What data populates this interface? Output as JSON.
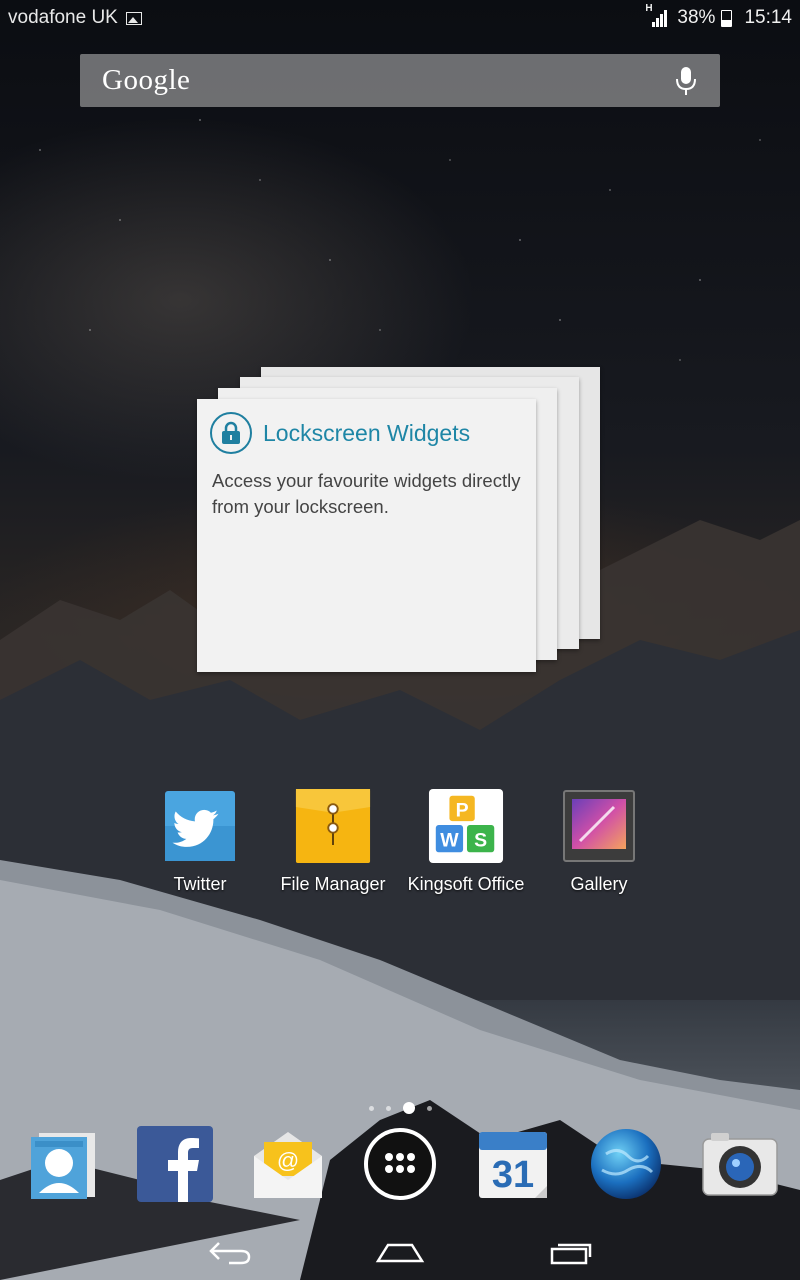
{
  "status_bar": {
    "carrier": "vodafone UK",
    "network_type": "H",
    "battery_percent": "38%",
    "battery_level": 0.38,
    "time": "15:14"
  },
  "search": {
    "logo_text": "Google",
    "mic_icon": "microphone-icon"
  },
  "widget": {
    "title": "Lockscreen Widgets",
    "description": "Access your favourite widgets directly from your lockscreen.",
    "icon": "lock-icon",
    "accent_color": "#1e86a6"
  },
  "apps": [
    {
      "label": "Twitter",
      "icon": "twitter-icon"
    },
    {
      "label": "File Manager",
      "icon": "file-manager-icon"
    },
    {
      "label": "Kingsoft Office",
      "icon": "kingsoft-office-icon"
    },
    {
      "label": "Gallery",
      "icon": "gallery-icon"
    }
  ],
  "page_indicator": {
    "count": 4,
    "active": 3
  },
  "dock": [
    {
      "name": "contacts",
      "icon": "contacts-icon"
    },
    {
      "name": "facebook",
      "icon": "facebook-icon"
    },
    {
      "name": "email",
      "icon": "email-icon"
    },
    {
      "name": "app-drawer",
      "icon": "app-drawer-icon"
    },
    {
      "name": "calendar",
      "icon": "calendar-icon",
      "day": "31"
    },
    {
      "name": "browser",
      "icon": "globe-icon"
    },
    {
      "name": "camera",
      "icon": "camera-icon"
    }
  ],
  "nav": [
    {
      "name": "back",
      "icon": "back-icon"
    },
    {
      "name": "home",
      "icon": "home-icon"
    },
    {
      "name": "recents",
      "icon": "recents-icon"
    }
  ]
}
